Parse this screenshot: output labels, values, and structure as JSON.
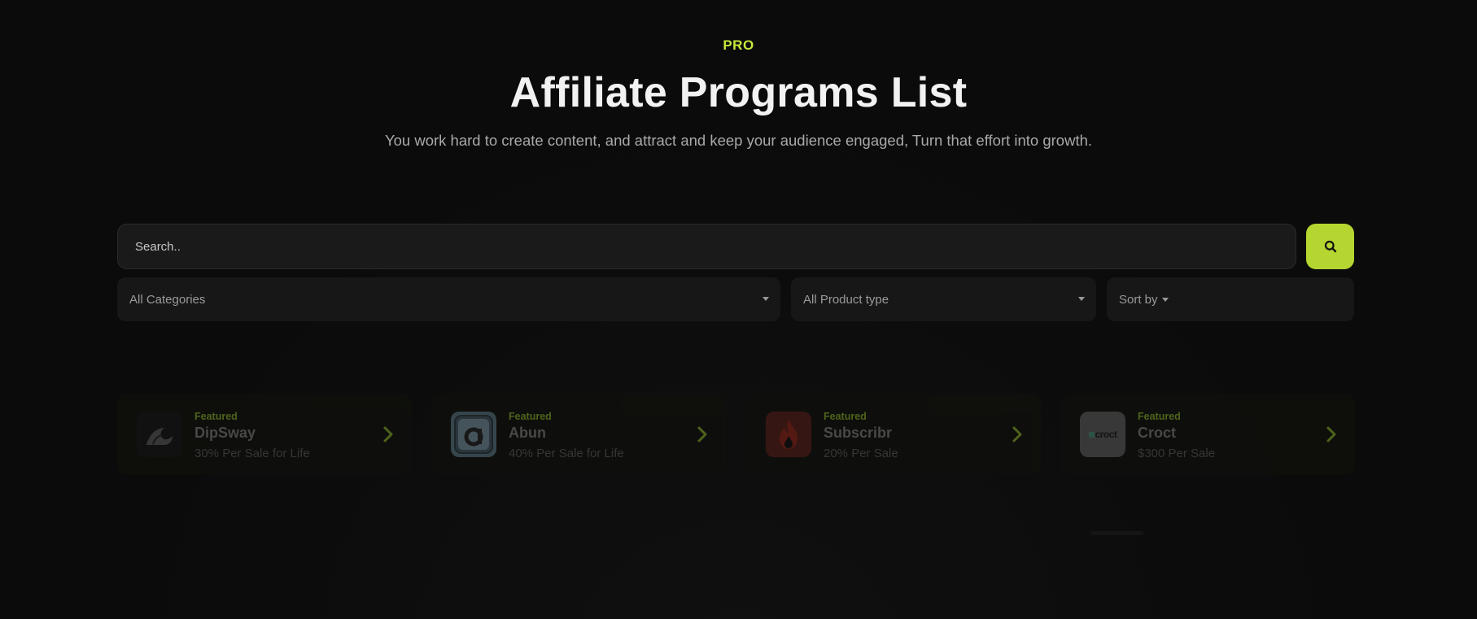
{
  "hero": {
    "eyebrow": "PRO",
    "title": "Affiliate Programs List",
    "subtitle": "You work hard to create content, and attract and keep your audience engaged, Turn that effort into growth."
  },
  "search": {
    "placeholder": "Search..",
    "button_icon": "search-icon"
  },
  "filters": {
    "categories": "All Categories",
    "product_type": "All Product type",
    "sort_by": "Sort by"
  },
  "programs": [
    {
      "badge": "Featured",
      "name": "DipSway",
      "commission": "30% Per Sale for Life",
      "logo_icon": "wave-icon"
    },
    {
      "badge": "Featured",
      "name": "Abun",
      "commission": "40% Per Sale for Life",
      "logo_icon": "letter-a-icon"
    },
    {
      "badge": "Featured",
      "name": "Subscribr",
      "commission": "20% Per Sale",
      "logo_icon": "flame-icon"
    },
    {
      "badge": "Featured",
      "name": "Croct",
      "commission": "$300 Per Sale",
      "logo_icon": "croct-logo-icon",
      "logo_text": "croct"
    }
  ],
  "colors": {
    "accent": "#b5d531",
    "eyebrow": "#c5e83a",
    "background": "#0b0b0b"
  }
}
